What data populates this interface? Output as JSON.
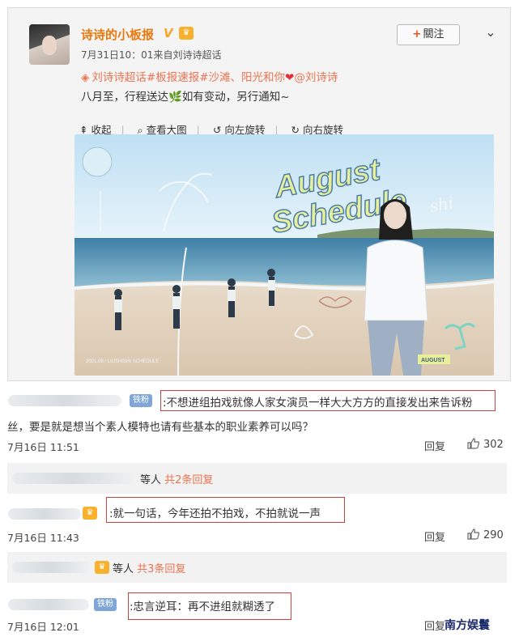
{
  "post": {
    "username": "诗诗的小板报",
    "verified_badge": "V",
    "meta": "7月31日10：01来自刘诗诗超话",
    "follow_plus": "+",
    "follow_label": "關注",
    "line1_topic1": "刘诗诗超话",
    "line1_topic2": "#板报速报#沙滩、阳光和你",
    "line1_mention": "@刘诗诗",
    "line2_a": "八月至，行程送达",
    "line2_b": "如有变动，另行通知~",
    "toolbar": {
      "collect": "收起",
      "view_large": "查看大图",
      "rotate_left": "向左旋转",
      "rotate_right": "向右旋转"
    }
  },
  "photo": {
    "title_line1": "August",
    "title_line2": "Schedule",
    "signature": "shi",
    "footer_left": "2021.08 / LIUSHISHI SCHEDULE",
    "footer_badge": "AUGUST"
  },
  "comments": [
    {
      "badge": "铁粉",
      "text_line1": ":不想进组拍戏就像人家女演员一样大大方方的直接发出来告诉粉",
      "text_line2": "丝，要是就是想当个素人模特也请有些基本的职业素养可以吗？",
      "time": "7月16日 11:51",
      "reply_label": "回复",
      "likes": "302"
    },
    {
      "text": ":就一句话，今年还拍不拍戏，不拍就说一声",
      "time": "7月16日 11:43",
      "reply_label": "回复",
      "likes": "290"
    },
    {
      "badge": "铁粉",
      "text": ":忠言逆耳：再不进组就糊透了",
      "time": "7月16日 12:01",
      "reply_label": "回复"
    }
  ],
  "subreplies": [
    {
      "who": "等人",
      "count": "共2条回复"
    },
    {
      "who": "等人",
      "count": "共3条回复"
    }
  ],
  "watermark": "南方娱鬟",
  "colors": {
    "accent_orange": "#eb7350",
    "highlight_box": "#c9453b",
    "iron_badge": "#7fa6d6"
  }
}
